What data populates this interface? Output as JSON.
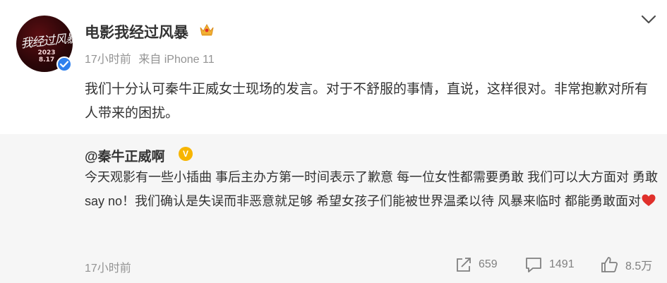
{
  "post": {
    "user_name": "电影我经过风暴",
    "avatar_text": "我经过风暴",
    "avatar_date": "2023 8.17",
    "time": "17小时前",
    "source": "来自 iPhone 11",
    "text": "我们十分认可秦牛正威女士现场的发言。对于不舒服的事情，直说，这样很对。非常抱歉对所有人带来的困扰。"
  },
  "repost": {
    "user": "@秦牛正威啊",
    "verified_letter": "V",
    "text": "今天观影有一些小插曲 事后主办方第一时间表示了歉意 每一位女性都需要勇敢 我们可以大方面对 勇敢say no！我们确认是失误而非恶意就足够 希望女孩子们能被世界温柔以待 风暴来临时 都能勇敢面对",
    "time": "17小时前",
    "share_count": "659",
    "comment_count": "1491",
    "like_count": "8.5万"
  },
  "icons": {
    "crown": "crown-icon",
    "verified": "verified-badge-icon",
    "more": "chevron-down-icon",
    "heart": "heart-icon",
    "share": "share-icon",
    "comment": "comment-icon",
    "like": "like-icon"
  },
  "colors": {
    "verified_blue": "#2f80ed",
    "gold_v": "#f7b500",
    "repost_bg": "#f6f6f6",
    "meta_gray": "#939393",
    "heart_red": "#e0302b"
  }
}
